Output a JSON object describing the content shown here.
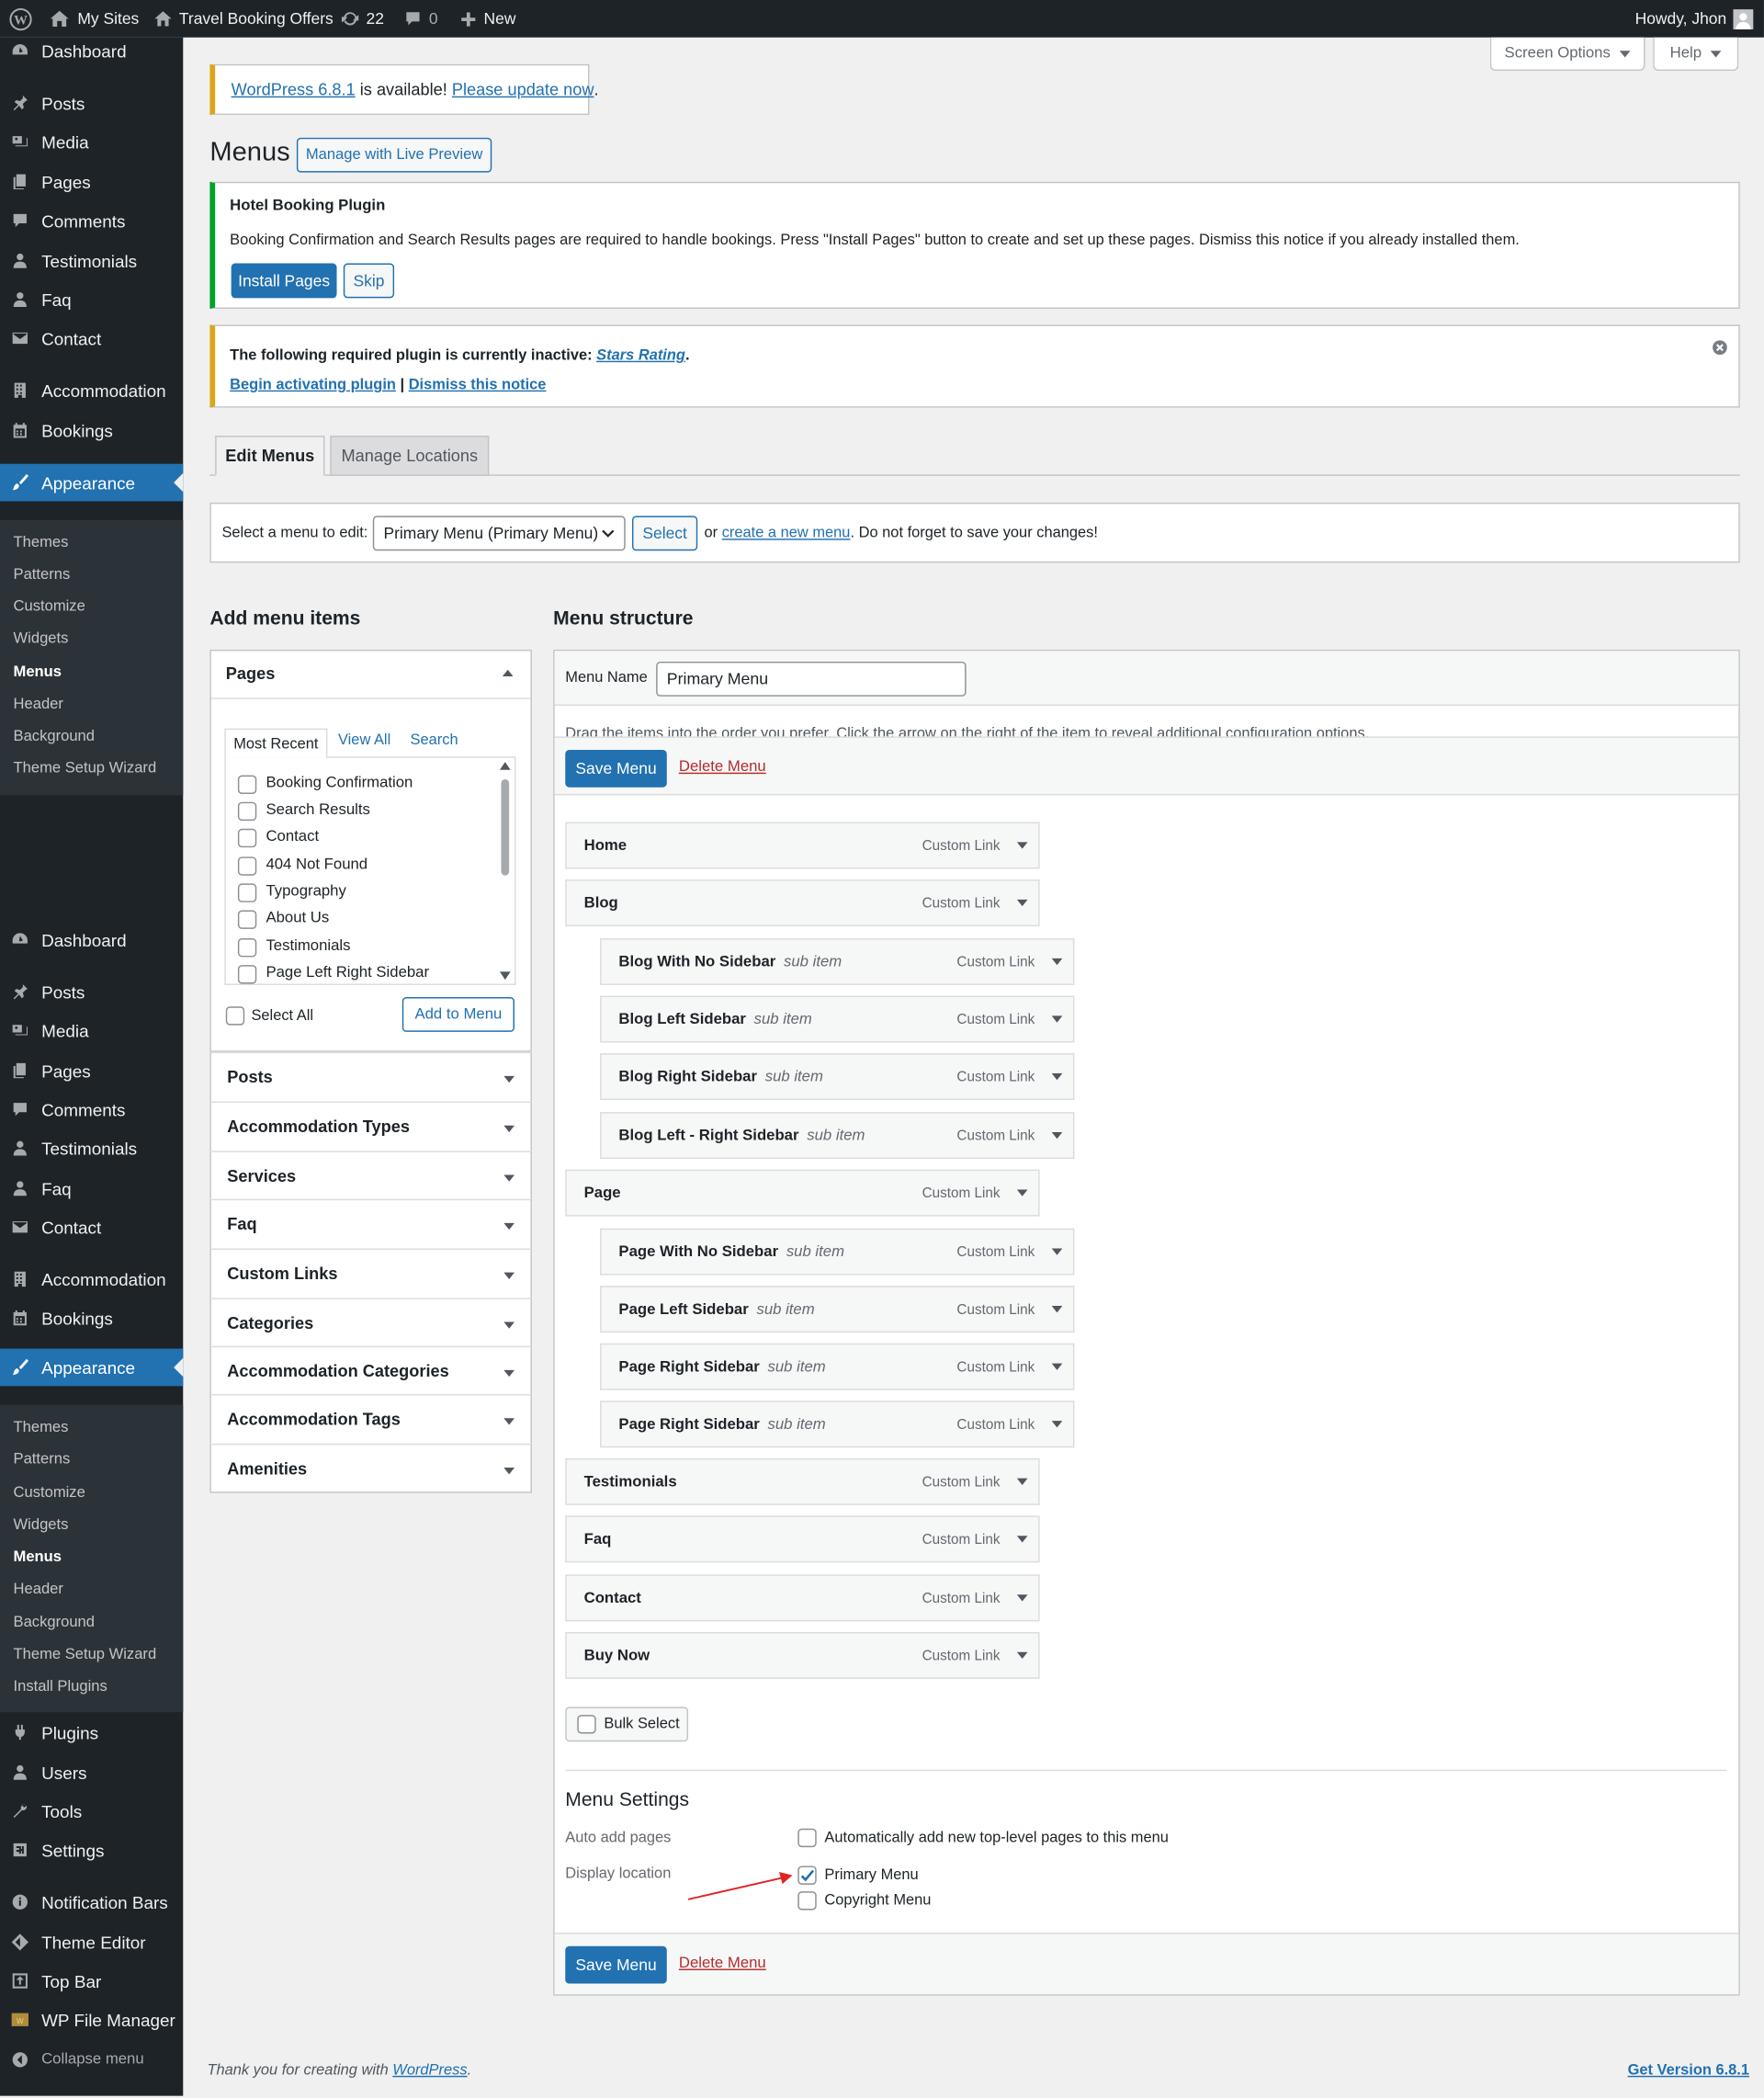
{
  "admin_bar": {
    "my_sites": "My Sites",
    "site_name": "Travel Booking Offers",
    "updates_count": "22",
    "comments_count": "0",
    "new_label": "New",
    "howdy": "Howdy, Jhon"
  },
  "sidebar": {
    "group1": [
      "Dashboard",
      "Posts",
      "Media",
      "Pages",
      "Comments",
      "Testimonials",
      "Faq",
      "Contact",
      "Accommodation",
      "Bookings",
      "Appearance"
    ],
    "sub1": [
      "Themes",
      "Patterns",
      "Customize",
      "Widgets",
      "Menus",
      "Header",
      "Background",
      "Theme Setup Wizard"
    ],
    "group2": [
      "Dashboard",
      "Posts",
      "Media",
      "Pages",
      "Comments",
      "Testimonials",
      "Faq",
      "Contact",
      "Accommodation",
      "Bookings",
      "Appearance"
    ],
    "sub2": [
      "Themes",
      "Patterns",
      "Customize",
      "Widgets",
      "Menus",
      "Header",
      "Background",
      "Theme Setup Wizard",
      "Install Plugins"
    ],
    "group3": [
      "Plugins",
      "Users",
      "Tools",
      "Settings",
      "Notification Bars",
      "Theme Editor",
      "Top Bar",
      "WP File Manager",
      "Collapse menu"
    ]
  },
  "screen_options": "Screen Options",
  "help": "Help",
  "update_notice": {
    "link": "WordPress 6.8.1",
    "text": " is available! ",
    "link2": "Please update now",
    "end": "."
  },
  "page_title": "Menus",
  "live_preview": "Manage with Live Preview",
  "hotel_notice": {
    "title": "Hotel Booking Plugin",
    "text": "Booking Confirmation and Search Results pages are required to handle bookings. Press \"Install Pages\" button to create and set up these pages. Dismiss this notice if you already installed them.",
    "install": "Install Pages",
    "skip": "Skip"
  },
  "plugin_notice": {
    "text": "The following required plugin is currently inactive: ",
    "plugin": "Stars Rating",
    "dot": ".",
    "activate": "Begin activating plugin",
    "sep": "|",
    "dismiss": "Dismiss this notice"
  },
  "tabs": {
    "edit": "Edit Menus",
    "manage": "Manage Locations"
  },
  "select_bar": {
    "label": "Select a menu to edit:",
    "selected": "Primary Menu (Primary Menu)",
    "select_btn": "Select",
    "or": "or",
    "create": "create a new menu",
    "rest": ". Do not forget to save your changes!"
  },
  "add_items": {
    "heading": "Add menu items",
    "pages_title": "Pages",
    "tabs": [
      "Most Recent",
      "View All",
      "Search"
    ],
    "pages": [
      "Booking Confirmation",
      "Search Results",
      "Contact",
      "404 Not Found",
      "Typography",
      "About Us",
      "Testimonials",
      "Page Left Right Sidebar"
    ],
    "select_all": "Select All",
    "add_to_menu": "Add to Menu",
    "accordions": [
      "Posts",
      "Accommodation Types",
      "Services",
      "Faq",
      "Custom Links",
      "Categories",
      "Accommodation Categories",
      "Accommodation Tags",
      "Amenities"
    ]
  },
  "structure": {
    "heading": "Menu structure",
    "name_label": "Menu Name",
    "name_value": "Primary Menu",
    "hint": "Drag the items into the order you prefer. Click the arrow on the right of the item to reveal additional configuration options.",
    "save": "Save Menu",
    "delete": "Delete Menu",
    "items": [
      {
        "title": "Home",
        "sub": "",
        "type": "Custom Link"
      },
      {
        "title": "Blog",
        "sub": "",
        "type": "Custom Link"
      },
      {
        "title": "Blog With No Sidebar",
        "sub": "sub item",
        "type": "Custom Link"
      },
      {
        "title": "Blog Left Sidebar",
        "sub": "sub item",
        "type": "Custom Link"
      },
      {
        "title": "Blog Right Sidebar",
        "sub": "sub item",
        "type": "Custom Link"
      },
      {
        "title": "Blog Left - Right Sidebar",
        "sub": "sub item",
        "type": "Custom Link"
      },
      {
        "title": "Page",
        "sub": "",
        "type": "Custom Link"
      },
      {
        "title": "Page With No Sidebar",
        "sub": "sub item",
        "type": "Custom Link"
      },
      {
        "title": "Page Left Sidebar",
        "sub": "sub item",
        "type": "Custom Link"
      },
      {
        "title": "Page Right Sidebar",
        "sub": "sub item",
        "type": "Custom Link"
      },
      {
        "title": "Page Right Sidebar",
        "sub": "sub item",
        "type": "Custom Link"
      },
      {
        "title": "Testimonials",
        "sub": "",
        "type": "Custom Link"
      },
      {
        "title": "Faq",
        "sub": "",
        "type": "Custom Link"
      },
      {
        "title": "Contact",
        "sub": "",
        "type": "Custom Link"
      },
      {
        "title": "Buy Now",
        "sub": "",
        "type": "Custom Link"
      }
    ],
    "bulk": "Bulk Select",
    "settings": {
      "heading": "Menu Settings",
      "auto_label": "Auto add pages",
      "auto_text": "Automatically add new top-level pages to this menu",
      "loc_label": "Display location",
      "primary": "Primary Menu",
      "copyright": "Copyright Menu"
    }
  },
  "footer": {
    "text": "Thank you for creating with ",
    "link": "WordPress",
    "dot": ".",
    "version": "Get Version 6.8.1"
  }
}
